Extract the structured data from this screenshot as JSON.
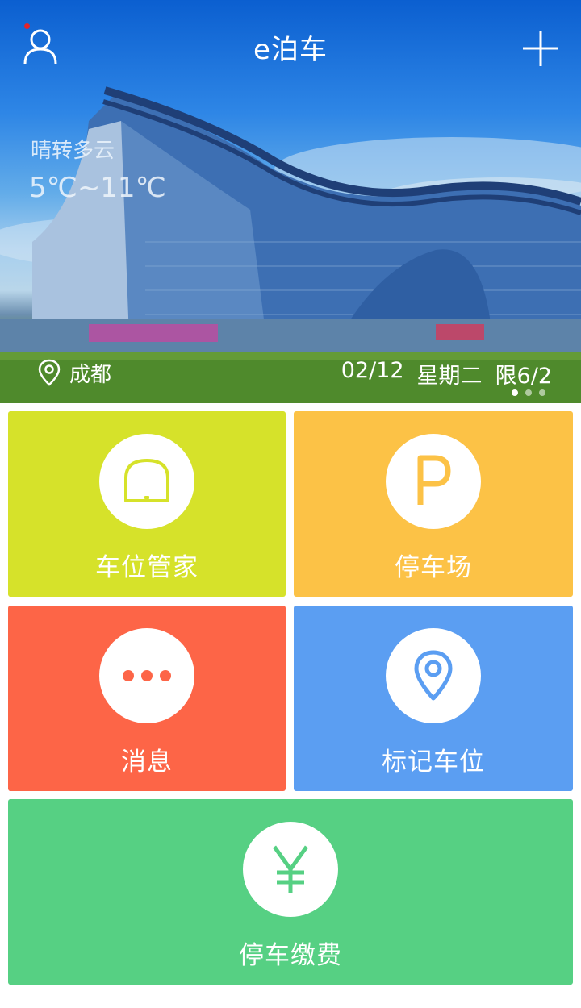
{
  "header": {
    "title": "e泊车",
    "user_icon": "user-icon",
    "add_icon": "plus-icon",
    "notification_color": "#e3242b"
  },
  "weather": {
    "description": "晴转多云",
    "temperature": "5℃~11℃"
  },
  "location": {
    "city": "成都",
    "icon": "location-pin-icon"
  },
  "date_info": {
    "date": "02/12",
    "weekday": "星期二",
    "restriction": "限6/2"
  },
  "carousel": {
    "pages": 3,
    "active_index": 0
  },
  "tiles": [
    {
      "label": "车位管家",
      "icon": "parking-space-icon",
      "color": "#d6e22a"
    },
    {
      "label": "停车场",
      "icon": "parking-p-icon",
      "color": "#fcc246"
    },
    {
      "label": "消息",
      "icon": "message-dots-icon",
      "color": "#fd6547"
    },
    {
      "label": "标记车位",
      "icon": "location-pin-icon",
      "color": "#5b9ef2"
    },
    {
      "label": "停车缴费",
      "icon": "yen-icon",
      "color": "#56d083"
    }
  ]
}
